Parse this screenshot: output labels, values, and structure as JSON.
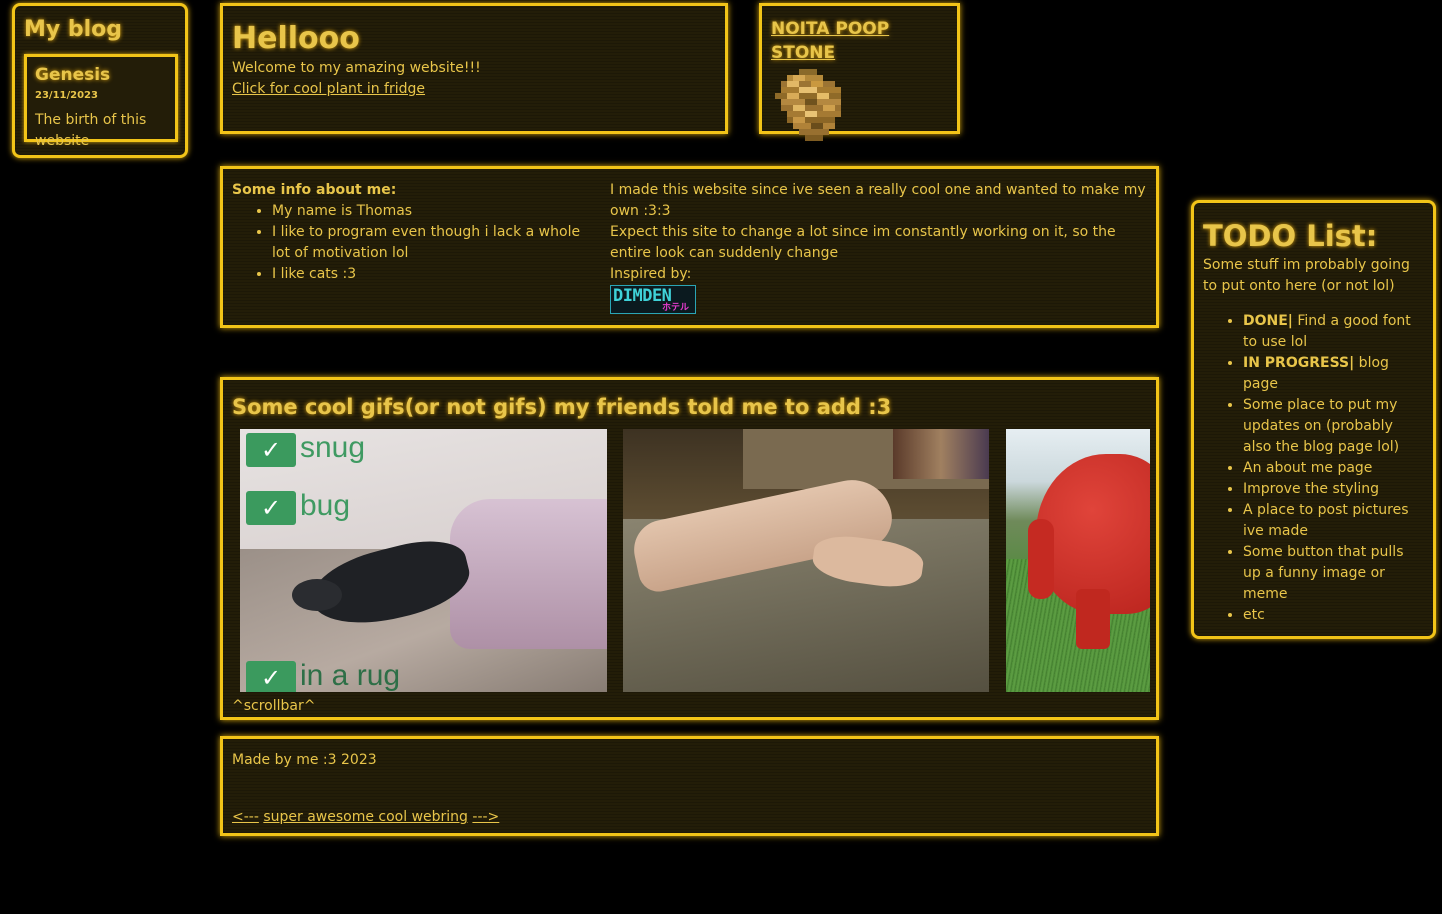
{
  "blog": {
    "title": "My blog",
    "post": {
      "title": "Genesis",
      "date": "23/11/2023",
      "text": "The birth of this website"
    }
  },
  "hello": {
    "title": "Hellooo",
    "welcome": "Welcome to my amazing website!!!",
    "link": "Click for cool plant in fridge"
  },
  "noita": {
    "title": "NOITA POOP STONE"
  },
  "info": {
    "heading": "Some info about me:",
    "items": [
      "My name is Thomas",
      "I like to program even though i lack a whole lot of motivation lol",
      "I like cats :3"
    ],
    "para1": "I made this website since ive seen a really cool one and wanted to make my own :3:3",
    "para2": "Expect this site to change a lot since im constantly working on it, so the entire look can suddenly change",
    "inspired": "Inspired by:",
    "badge_main": "DIMDEN",
    "badge_sub": "ホテル"
  },
  "gifs": {
    "title": "Some cool gifs(or not gifs) my friends told me to add :3",
    "captions": [
      "snug",
      "bug",
      "in a rug"
    ],
    "scrollbar_note": "^scrollbar^"
  },
  "footer": {
    "made_by": "Made by me :3 2023",
    "prev": "<---",
    "webring": "super awesome cool webring",
    "next": "--->"
  },
  "todo": {
    "title": "TODO List:",
    "intro": "Some stuff im probably going to put onto here (or not lol)",
    "items": [
      {
        "tag": "DONE|",
        "text": " Find a good font to use lol"
      },
      {
        "tag": "IN PROGRESS|",
        "text": " blog page"
      },
      {
        "tag": "",
        "text": "Some place to put my updates on (probably also the blog page lol)"
      },
      {
        "tag": "",
        "text": "An about me page"
      },
      {
        "tag": "",
        "text": "Improve the styling"
      },
      {
        "tag": "",
        "text": "A place to post pictures ive made"
      },
      {
        "tag": "",
        "text": "Some button that pulls up a funny image or meme"
      },
      {
        "tag": "",
        "text": "etc"
      }
    ]
  },
  "colors": {
    "accent": "#f2c418",
    "text": "#e8c54a",
    "panel_bg": "#231d08",
    "page_bg": "#000000"
  }
}
